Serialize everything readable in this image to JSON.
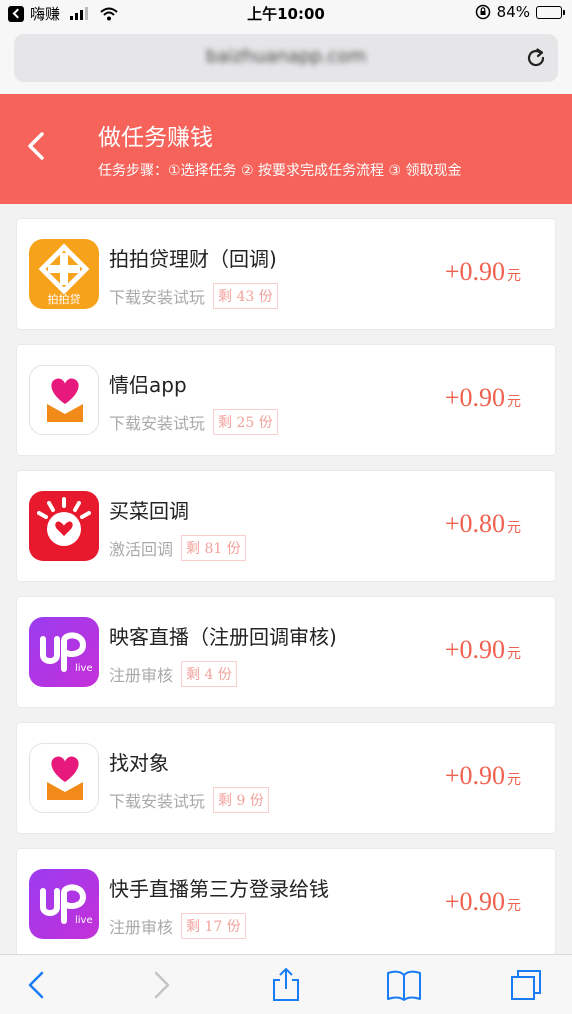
{
  "status_bar": {
    "back_app": "嗨赚",
    "time": "上午10:00",
    "battery": "84%",
    "battery_level": 0.84
  },
  "url_bar": {
    "url": "baizhuanapp.com"
  },
  "header": {
    "title": "做任务赚钱",
    "steps": "任务步骤：①选择任务 ② 按要求完成任务流程 ③ 领取现金"
  },
  "tasks": [
    {
      "name": "拍拍贷理财（回调)",
      "type": "下载安装试玩",
      "remain": "剩 43 份",
      "reward": "+0.90",
      "unit": "元",
      "icon": "paipaidai-icon",
      "icon_label": "拍拍贷"
    },
    {
      "name": "情侣app",
      "type": "下载安装试玩",
      "remain": "剩 25 份",
      "reward": "+0.90",
      "unit": "元",
      "icon": "couple-heart-icon"
    },
    {
      "name": "买菜回调",
      "type": "激活回调",
      "remain": "剩 81 份",
      "reward": "+0.80",
      "unit": "元",
      "icon": "maicai-face-icon"
    },
    {
      "name": "映客直播（注册回调审核)",
      "type": "注册审核",
      "remain": "剩 4 份",
      "reward": "+0.90",
      "unit": "元",
      "icon": "up-live-icon"
    },
    {
      "name": "找对象",
      "type": "下载安装试玩",
      "remain": "剩 9 份",
      "reward": "+0.90",
      "unit": "元",
      "icon": "couple-heart-icon"
    },
    {
      "name": "快手直播第三方登录给钱",
      "type": "注册审核",
      "remain": "剩 17 份",
      "reward": "+0.90",
      "unit": "元",
      "icon": "up-live-icon"
    }
  ],
  "colors": {
    "header_bg": "#f5635a",
    "reward": "#f0614f",
    "remain_text": "#f3a29c"
  }
}
